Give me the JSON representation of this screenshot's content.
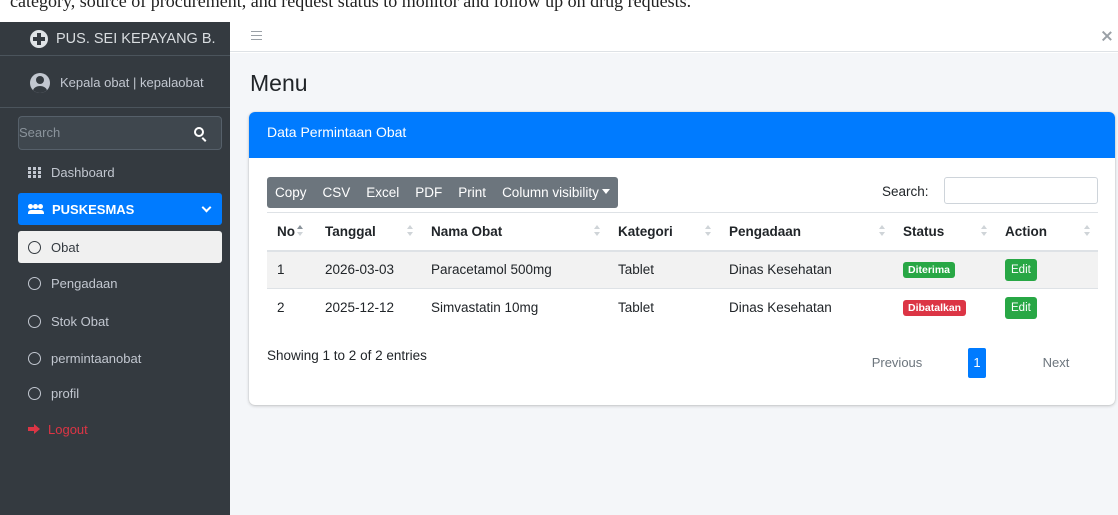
{
  "caption": "category, source of procurement, and request status to monitor and follow up on drug requests.",
  "brand": {
    "name": "PUS. SEI KEPAYANG B."
  },
  "user": {
    "name": "Kepala obat | kepalaobat"
  },
  "sidebar": {
    "search_placeholder": "Search",
    "items": [
      {
        "label": "Dashboard",
        "icon": "grid-icon"
      },
      {
        "label": "PUSKESMAS",
        "icon": "users-icon"
      },
      {
        "label": "Obat",
        "icon": "circle-icon"
      },
      {
        "label": "Pengadaan",
        "icon": "circle-icon"
      },
      {
        "label": "Stok Obat",
        "icon": "circle-icon"
      },
      {
        "label": "permintaanobat",
        "icon": "circle-icon"
      },
      {
        "label": "profil",
        "icon": "circle-icon"
      },
      {
        "label": "Logout",
        "icon": "logout-icon"
      }
    ]
  },
  "page": {
    "title": "Menu"
  },
  "card": {
    "title": "Data Permintaan Obat"
  },
  "toolbar": {
    "buttons": [
      "Copy",
      "CSV",
      "Excel",
      "PDF",
      "Print",
      "Column visibility"
    ],
    "search_label": "Search:",
    "search_value": ""
  },
  "table": {
    "columns": [
      "No",
      "Tanggal",
      "Nama Obat",
      "Kategori",
      "Pengadaan",
      "Status",
      "Action"
    ],
    "rows": [
      {
        "no": "1",
        "tanggal": "2026-03-03",
        "nama_obat": "Paracetamol 500mg",
        "kategori": "Tablet",
        "pengadaan": "Dinas Kesehatan",
        "status": "Diterima",
        "action": "Edit"
      },
      {
        "no": "2",
        "tanggal": "2025-12-12",
        "nama_obat": "Simvastatin 10mg",
        "kategori": "Tablet",
        "pengadaan": "Dinas Kesehatan",
        "status": "Dibatalkan",
        "action": "Edit"
      }
    ]
  },
  "footer": {
    "info": "Showing 1 to 2 of 2 entries",
    "previous": "Previous",
    "page": "1",
    "next": "Next"
  },
  "colors": {
    "primary": "#007bff",
    "sidebar": "#343a40",
    "success": "#28a745",
    "danger": "#dc3545",
    "secondary": "#6c757d"
  }
}
